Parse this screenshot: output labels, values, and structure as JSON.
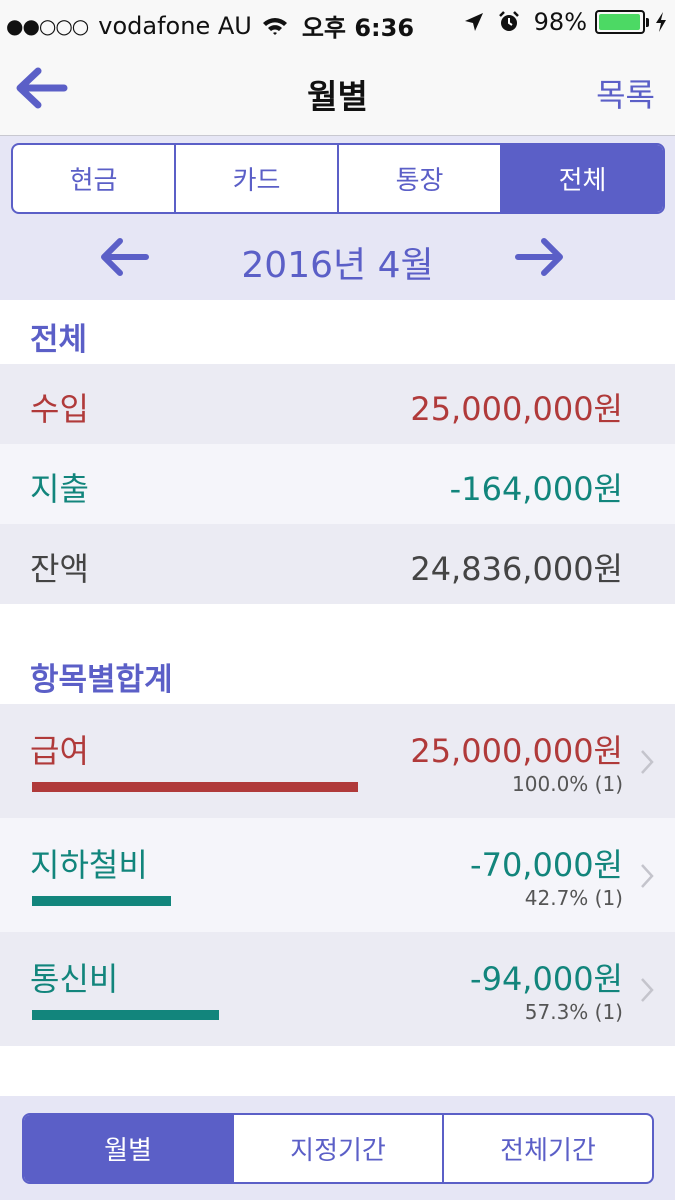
{
  "status_bar": {
    "signal": "●●○○○",
    "carrier": "vodafone AU",
    "time": "오후 6:36",
    "battery_pct": "98%",
    "battery_level": 0.98,
    "icons": [
      "wifi-icon",
      "location-arrow-icon",
      "alarm-clock-icon",
      "battery-icon",
      "charging-bolt-icon"
    ]
  },
  "nav": {
    "title": "월별",
    "right_label": "목록",
    "back_icon": "back-arrow-icon"
  },
  "account_tabs": {
    "items": [
      "현금",
      "카드",
      "통장",
      "전체"
    ],
    "selected": "전체"
  },
  "month_nav": {
    "label": "2016년 4월",
    "prev_icon": "left-arrow-icon",
    "next_icon": "right-arrow-icon"
  },
  "summary": {
    "header": "전체",
    "rows": [
      {
        "label": "수입",
        "value": "25,000,000원"
      },
      {
        "label": "지출",
        "value": "-164,000원"
      },
      {
        "label": "잔액",
        "value": "24,836,000원"
      }
    ]
  },
  "categories": {
    "header": "항목별합계",
    "rows": [
      {
        "label": "급여",
        "value": "25,000,000원",
        "meta": "100.0% (1)",
        "share": 1.0
      },
      {
        "label": "지하철비",
        "value": "-70,000원",
        "meta": "42.7% (1)",
        "share": 0.427
      },
      {
        "label": "통신비",
        "value": "-94,000원",
        "meta": "57.3% (1)",
        "share": 0.573
      }
    ]
  },
  "period_tabs": {
    "items": [
      "월별",
      "지정기간",
      "전체기간"
    ],
    "selected": "월별"
  },
  "colors": {
    "accent": "#5b5fc7",
    "income": "#b03a3a",
    "expense": "#12857c",
    "balance": "#444444",
    "panel": "#e6e6f5"
  }
}
